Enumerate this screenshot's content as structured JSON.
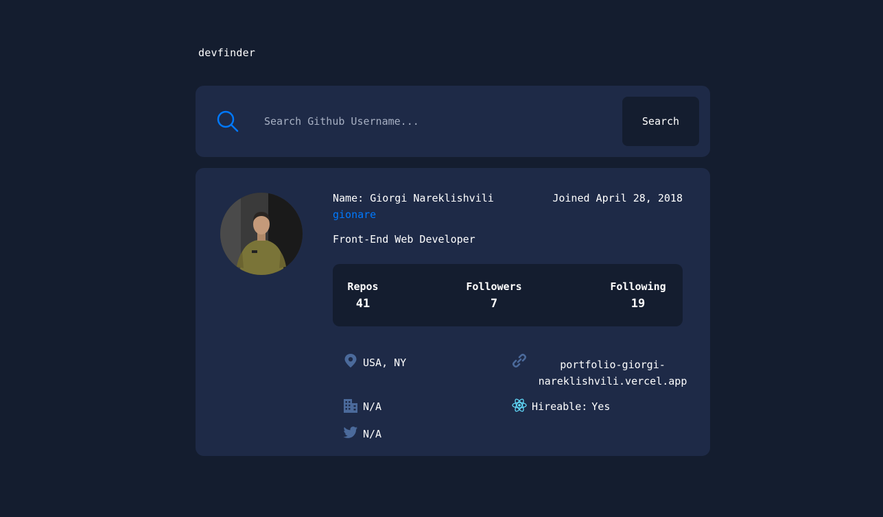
{
  "app": {
    "title": "devfinder"
  },
  "search": {
    "placeholder": "Search Github Username...",
    "value": "",
    "button_label": "Search"
  },
  "profile": {
    "name_label": "Name:",
    "name": "Giorgi Nareklishvili",
    "joined": "Joined April 28, 2018",
    "username": "gionare",
    "bio": "Front-End Web Developer",
    "avatar_alt": "avatar",
    "stats": {
      "repos_label": "Repos",
      "repos_value": "41",
      "followers_label": "Followers",
      "followers_value": "7",
      "following_label": "Following",
      "following_value": "19"
    },
    "info": {
      "location": "USA, NY",
      "company": "N/A",
      "twitter": "N/A",
      "website": "portfolio-giorgi-nareklishvili.vercel.app",
      "hireable_label": "Hireable:",
      "hireable_value": "Yes"
    }
  },
  "icons": {
    "search": "search-icon",
    "location": "map-pin-icon",
    "company": "building-icon",
    "twitter": "twitter-icon",
    "website": "link-icon",
    "hireable": "react-atom-icon"
  },
  "colors": {
    "background": "#141d2f",
    "card": "#1e2a47",
    "accent": "#0079ff",
    "icon_muted": "#4b6a9b",
    "react": "#61dafb"
  }
}
